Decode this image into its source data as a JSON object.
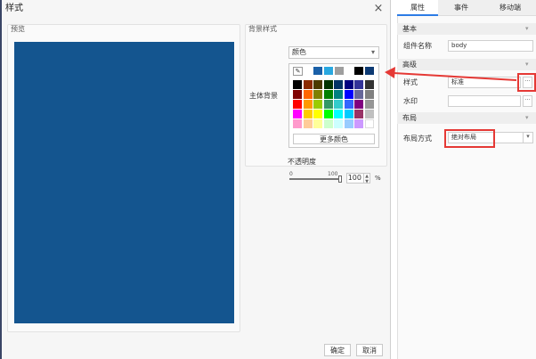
{
  "dialog": {
    "title": "样式",
    "close_icon": "×",
    "preview_label": "预览",
    "bg_style_label": "背景样式",
    "main_bg_label": "主体背景",
    "color_mode_value": "颜色",
    "more_colors_label": "更多颜色",
    "opacity_label": "不透明度",
    "slider_min": "0",
    "slider_max": "100",
    "opacity_value": "100",
    "opacity_unit": "%",
    "ok_label": "确定",
    "cancel_label": "取消",
    "preview_color": "#14558f",
    "recent_colors": [
      "#1a60a8",
      "#29a8e0",
      "#9e9e9e",
      "#000000",
      "#0d3a73"
    ],
    "palette": [
      [
        "#000000",
        "#8b2b00",
        "#4a3a00",
        "#003300",
        "#003366",
        "#000080",
        "#333399",
        "#333333"
      ],
      [
        "#800000",
        "#ff6600",
        "#808000",
        "#008000",
        "#008080",
        "#0000ff",
        "#666699",
        "#808080"
      ],
      [
        "#ff0000",
        "#ff9900",
        "#99cc00",
        "#339966",
        "#33cccc",
        "#3366ff",
        "#800080",
        "#969696"
      ],
      [
        "#ff00ff",
        "#ffcc00",
        "#ffff00",
        "#00ff00",
        "#00ffff",
        "#00ccff",
        "#993366",
        "#c0c0c0"
      ],
      [
        "#ff99cc",
        "#ffcc99",
        "#ffff99",
        "#ccffcc",
        "#ccffff",
        "#99ccff",
        "#cc99ff",
        "#ffffff"
      ]
    ]
  },
  "panel": {
    "tabs": [
      {
        "label": "属性",
        "active": true
      },
      {
        "label": "事件",
        "active": false
      },
      {
        "label": "移动端",
        "active": false
      }
    ],
    "sections": {
      "basic": "基本",
      "advanced": "高级",
      "layout": "布局"
    },
    "component_name_label": "组件名称",
    "component_name_value": "body",
    "style_label": "样式",
    "style_value": "标准",
    "watermark_label": "水印",
    "watermark_value": "",
    "layout_mode_label": "布局方式",
    "layout_mode_value": "绝对布局",
    "dots": "···",
    "chevron": "▾"
  },
  "colors": {
    "accent": "#2c7be5",
    "annotation_red": "#e53935"
  }
}
